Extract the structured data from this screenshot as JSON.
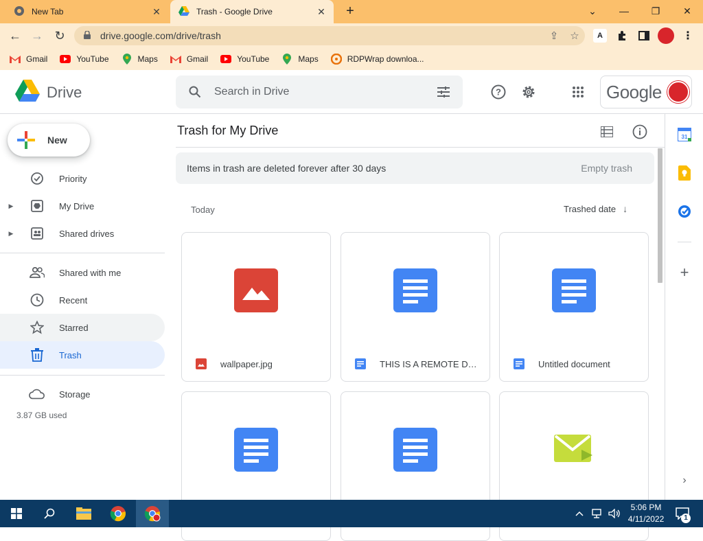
{
  "browser": {
    "tabs": [
      {
        "title": "New Tab",
        "icon": "chrome-icon"
      },
      {
        "title": "Trash - Google Drive",
        "icon": "drive-icon"
      }
    ],
    "url": "drive.google.com/drive/trash",
    "bookmarks": [
      {
        "label": "Gmail",
        "icon": "gmail-icon"
      },
      {
        "label": "YouTube",
        "icon": "youtube-icon"
      },
      {
        "label": "Maps",
        "icon": "maps-icon"
      },
      {
        "label": "Gmail",
        "icon": "gmail-icon"
      },
      {
        "label": "YouTube",
        "icon": "youtube-icon"
      },
      {
        "label": "Maps",
        "icon": "maps-icon"
      },
      {
        "label": "RDPWrap downloa...",
        "icon": "rdpwrap-icon"
      }
    ]
  },
  "drive": {
    "app_name": "Drive",
    "search_placeholder": "Search in Drive",
    "account_brand": "Google",
    "new_label": "New",
    "nav": [
      {
        "label": "Priority",
        "icon": "priority-icon"
      },
      {
        "label": "My Drive",
        "icon": "my-drive-icon"
      },
      {
        "label": "Shared drives",
        "icon": "shared-drives-icon"
      },
      {
        "label": "Shared with me",
        "icon": "shared-with-me-icon"
      },
      {
        "label": "Recent",
        "icon": "recent-icon"
      },
      {
        "label": "Starred",
        "icon": "star-icon"
      },
      {
        "label": "Trash",
        "icon": "trash-icon",
        "selected": true
      }
    ],
    "storage": {
      "label": "Storage",
      "used": "3.87 GB used"
    },
    "page_title": "Trash for My Drive",
    "banner": {
      "text": "Items in trash are deleted forever after 30 days",
      "action": "Empty trash"
    },
    "section": "Today",
    "sort_label": "Trashed date",
    "files": [
      {
        "name": "wallpaper.jpg",
        "type": "image"
      },
      {
        "name": "THIS IS A REMOTE DES...",
        "type": "doc"
      },
      {
        "name": "Untitled document",
        "type": "doc"
      },
      {
        "name": "",
        "type": "doc"
      },
      {
        "name": "",
        "type": "doc"
      },
      {
        "name": "",
        "type": "email"
      }
    ]
  },
  "taskbar": {
    "time": "5:06 PM",
    "date": "4/11/2022",
    "notification_count": "1"
  },
  "colors": {
    "chrome_frame": "#fbbf6b",
    "chrome_toolbar": "#fdecd2",
    "drive_blue": "#4285f4",
    "image_red": "#db4437",
    "selected_nav_bg": "#e8f0fe",
    "taskbar": "#0c3a63"
  }
}
